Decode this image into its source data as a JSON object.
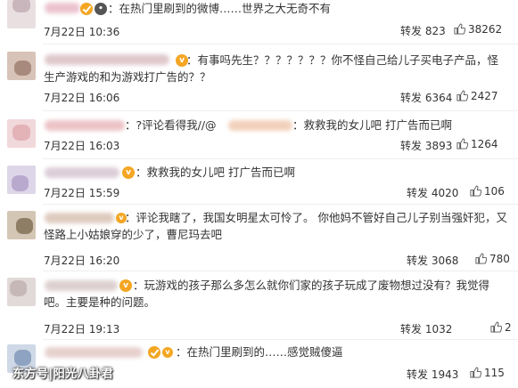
{
  "colors": {
    "text": "#333333",
    "divider": "#eeeeee",
    "badge": "#f4a623",
    "watermark": "#ffffff"
  },
  "like_icon": "thumb-up-icon",
  "comments": [
    {
      "text": "：在热门里刷到的微博……世界之大无奇不有",
      "time": "7月22日 10:36",
      "forward_label": "转发 823",
      "likes": "38262"
    },
    {
      "text": "：有事吗先生？？？？？？？你不怪自己给儿子买电子产品，怪生产游戏的和为游戏打广告的？？",
      "time": "7月22日 16:06",
      "forward_label": "转发 6364",
      "likes": "2427"
    },
    {
      "text": "：?评论看得我//@",
      "text_tail": "：救救我的女儿吧 打广告而已啊",
      "time": "7月22日 16:03",
      "forward_label": "转发 3893",
      "likes": "1264"
    },
    {
      "text": "：救救我的女儿吧 打广告而已啊",
      "time": "7月22日 15:59",
      "forward_label": "转发 4020",
      "likes": "106"
    },
    {
      "text": "：评论我瞎了，我国女明星太可怜了。 你他妈不管好自己儿子别当强奸犯，又怪路上小姑娘穿的少了，曹尼玛去吧",
      "time": "7月22日 16:20",
      "forward_label": "转发 3068",
      "likes": "780"
    },
    {
      "text": "：玩游戏的孩子那么多怎么就你们家的孩子玩成了废物想过没有？我觉得吧。主要是种的问题。",
      "time": "7月22日 19:13",
      "forward_label": "转发 1032",
      "likes": "2"
    },
    {
      "text": "：在热门里刷到的……感觉贼傻逼",
      "time": "",
      "forward_label": "转发 1943",
      "likes": "115"
    }
  ],
  "watermark": "东方号|阳光八卦君"
}
